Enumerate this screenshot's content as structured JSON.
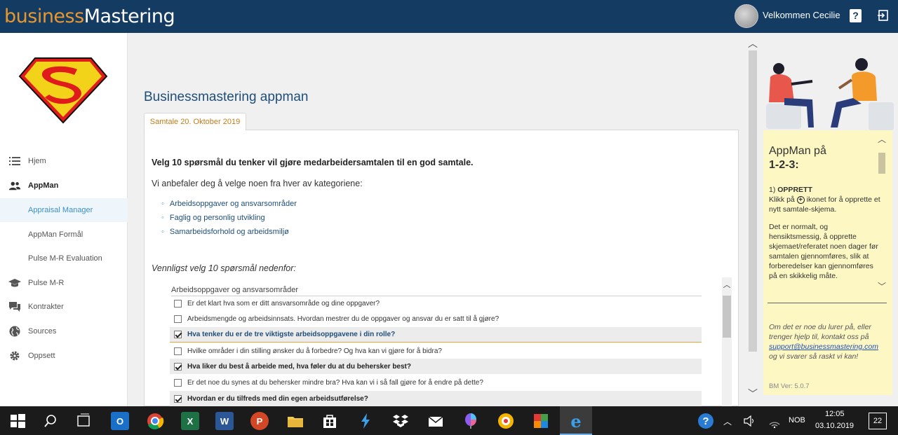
{
  "header": {
    "logo_part1": "business",
    "logo_part2": "Mastering",
    "welcome": "Velkommen Cecilie",
    "help_label": "?"
  },
  "sidebar": {
    "items": [
      {
        "label": "Hjem",
        "icon": "list-icon"
      },
      {
        "label": "AppMan",
        "icon": "people-icon"
      },
      {
        "label": "Appraisal Manager",
        "icon": ""
      },
      {
        "label": "AppMan Formål",
        "icon": ""
      },
      {
        "label": "Pulse M-R Evaluation",
        "icon": ""
      },
      {
        "label": "Pulse M-R",
        "icon": "graduation-cap-icon"
      },
      {
        "label": "Kontrakter",
        "icon": "chat-icon"
      },
      {
        "label": "Sources",
        "icon": "globe-icon"
      },
      {
        "label": "Oppsett",
        "icon": "gear-icon"
      }
    ],
    "selected": "Appraisal Manager"
  },
  "main": {
    "title": "Businessmastering appman",
    "tab_label": "Samtale 20. Oktober 2019",
    "heading": "Velg 10 spørsmål du tenker vil gjøre medarbeidersamtalen til en god samtale.",
    "subheading": "Vi anbefaler deg å velge noen fra hver av kategoriene:",
    "categories": [
      "Arbeidsoppgaver og ansvarsområder",
      "Faglig og personlig utvikling",
      "Samarbeidsforhold og arbeidsmiljø"
    ],
    "instruction": "Vennligst velg 10 spørsmål nedenfor:",
    "question_section": "Arbeidsoppgaver og ansvarsområder",
    "questions": [
      {
        "text": "Er det klart hva som er ditt ansvarsområde og dine oppgaver?",
        "checked": false
      },
      {
        "text": "Arbeidsmengde og arbeidsinnsats. Hvordan mestrer du de oppgaver og ansvar du er satt til å gjøre?",
        "checked": false
      },
      {
        "text": "Hva tenker du er de tre viktigste arbeidsoppgavene i din rolle?",
        "checked": true
      },
      {
        "text": "Hvilke områder i din stilling ønsker du å forbedre? Og hva kan vi gjøre for å bidra?",
        "checked": false
      },
      {
        "text": "Hva liker du best å arbeide med, hva føler du at du behersker best?",
        "checked": true
      },
      {
        "text": "Er det noe du synes at du behersker mindre bra? Hva kan vi i så fall gjøre for å endre på dette?",
        "checked": false
      },
      {
        "text": "Hvordan er du tilfreds med din egen arbeidsutførelse?",
        "checked": true
      }
    ]
  },
  "help": {
    "title_line1": "AppMan på",
    "title_line2": "1-2-3:",
    "step_number": "1)",
    "step_title": "OPPRETT",
    "step_text_a": "Klikk på",
    "step_text_b": "ikonet for å opprette et nytt samtale-skjema.",
    "paragraph": "Det er normalt, og hensiktsmessig, å opprette skjemaet/referatet noen dager før samtalen gjennomføres, slik at forberedelser kan gjennomføres på en skikkelig måte.",
    "contact_a": "Om det er noe du lurer på, eller trenger hjelp til, kontakt oss på",
    "contact_email": "support@businessmastering.com",
    "contact_b": "og vi svarer så raskt vi kan!",
    "version": "BM Ver: 5.0.7"
  },
  "taskbar": {
    "time": "12:05",
    "date": "03.10.2019",
    "language": "NOB",
    "notifications": "22"
  }
}
